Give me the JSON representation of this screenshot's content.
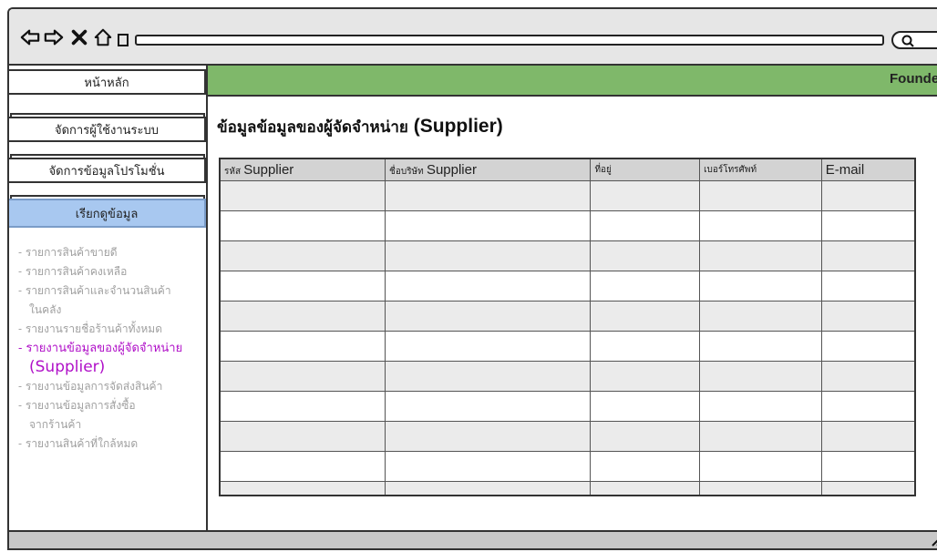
{
  "sidebar": {
    "home": "หน้าหลัก",
    "manage_users": "จัดการผู้ใช้งานระบบ",
    "manage_promo": "จัดการข้อมูลโปรโมชั่น",
    "view_data": "เรียกดูข้อมูล",
    "reports": [
      {
        "label": "- รายการสินค้าขายดี"
      },
      {
        "label": "- รายการสินค้าคงเหลือ"
      },
      {
        "label": "- รายการสินค้าและจำนวนสินค้า",
        "sub": "ในคลัง"
      },
      {
        "label": "- รายงานรายชื่อร้านค้าทั้งหมด"
      },
      {
        "label": "- รายงานข้อมูลของผู้จัดจำหน่าย",
        "sub": "(Supplier)"
      },
      {
        "label": "- รายงานข้อมูลการจัดส่งสินค้า"
      },
      {
        "label": "- รายงานข้อมูลการสั่งซื้อ",
        "sub": "จากร้านค้า"
      },
      {
        "label": "- รายงานสินค้าที่ใกล้หมด"
      }
    ]
  },
  "header": {
    "user": "Founder"
  },
  "page": {
    "title_th": "ข้อมูลข้อมูลของผู้จัดจำหน่าย",
    "title_en": "(Supplier)"
  },
  "table": {
    "columns": [
      {
        "th": "รหัส",
        "en": "Supplier"
      },
      {
        "th": "ชื่อบริษัท",
        "en": "Supplier"
      },
      {
        "th": "ที่อยู่",
        "en": ""
      },
      {
        "th": "เบอร์โทรศัพท์",
        "en": ""
      },
      {
        "th": "",
        "en": "E-mail"
      }
    ]
  },
  "colors": {
    "accent": "#7fb86a",
    "active_menu": "#a8c8f0",
    "active_link": "#b010c8"
  },
  "icons": [
    "back-arrow-icon",
    "forward-arrow-icon",
    "close-icon",
    "home-icon",
    "search-icon",
    "resize-icon"
  ]
}
